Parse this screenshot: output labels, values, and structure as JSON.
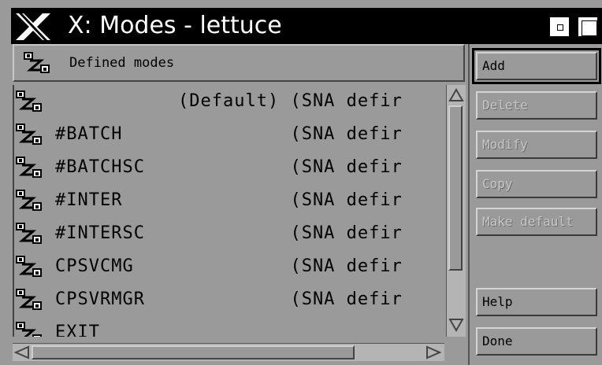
{
  "window": {
    "title": "X: Modes - lettuce"
  },
  "header": {
    "label": "Defined modes"
  },
  "modes": [
    {
      "name": "",
      "desc": "(Default) (SNA defir"
    },
    {
      "name": "#BATCH",
      "desc": "          (SNA defir"
    },
    {
      "name": "#BATCHSC",
      "desc": "          (SNA defir"
    },
    {
      "name": "#INTER",
      "desc": "          (SNA defir"
    },
    {
      "name": "#INTERSC",
      "desc": "          (SNA defir"
    },
    {
      "name": "CPSVCMG",
      "desc": "          (SNA defir"
    },
    {
      "name": "CPSVRMGR",
      "desc": "          (SNA defir"
    },
    {
      "name": "EXIT",
      "desc": ""
    }
  ],
  "buttons": {
    "add": "Add",
    "delete": "Delete",
    "modify": "Modify",
    "copy": "Copy",
    "make_default": "Make default",
    "help": "Help",
    "done": "Done"
  },
  "icons": {
    "window_menu": "x-logo-icon",
    "mode": "mode-icon"
  }
}
